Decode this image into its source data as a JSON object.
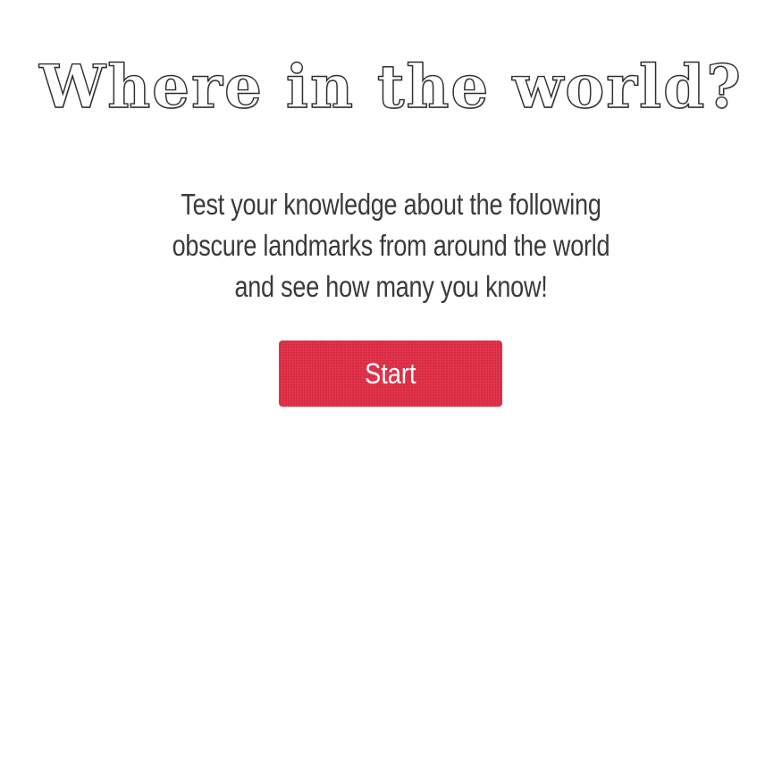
{
  "header": {
    "title": "Where in the world?"
  },
  "intro": {
    "text": "Test your knowledge about the following obscure landmarks from around the world and see how many you know!"
  },
  "actions": {
    "start_label": "Start"
  },
  "colors": {
    "accent": "#e02d45",
    "text": "#3a3a3a",
    "background": "#ffffff"
  }
}
